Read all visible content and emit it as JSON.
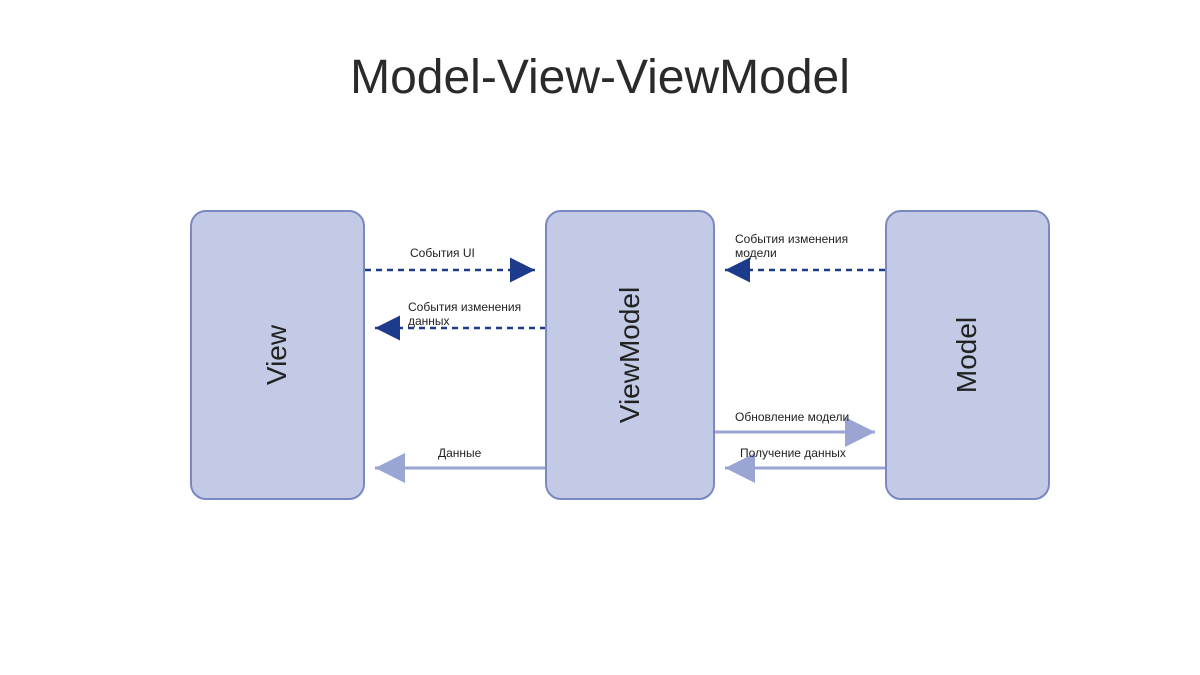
{
  "title": "Model-View-ViewModel",
  "boxes": {
    "view": "View",
    "viewmodel": "ViewModel",
    "model": "Model"
  },
  "arrows": {
    "ui_events": "События UI",
    "data_change_events": "События изменения\nданных",
    "data": "Данные",
    "model_change_events": "События изменения\nмодели",
    "update_model": "Обновление модели",
    "fetch_data": "Получение данных"
  },
  "colors": {
    "dashed": "#1e3a8a",
    "solid": "#9aa5d3"
  }
}
